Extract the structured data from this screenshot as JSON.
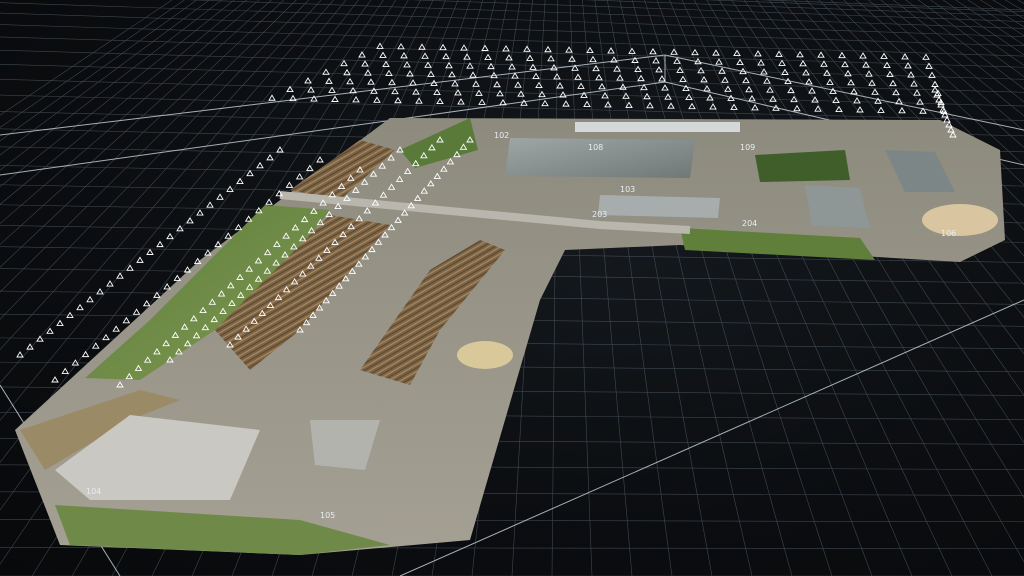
{
  "scene": {
    "type": "photogrammetry-3d-view",
    "subject": "industrial sawmill / timber yard point cloud",
    "colors": {
      "background": "#0a0c0e",
      "grid_line": "#5a6570",
      "grid_major": "#c9d2da",
      "camera_marker": "#ffffff"
    }
  },
  "gcp_labels": [
    {
      "id": "gcp-104",
      "text": "104"
    },
    {
      "id": "gcp-105",
      "text": "105"
    },
    {
      "id": "gcp-106",
      "text": "106"
    },
    {
      "id": "gcp-103",
      "text": "103"
    },
    {
      "id": "gcp-108",
      "text": "108"
    },
    {
      "id": "gcp-109",
      "text": "109"
    },
    {
      "id": "gcp-203",
      "text": "203"
    },
    {
      "id": "gcp-204",
      "text": "204"
    },
    {
      "id": "gcp-102",
      "text": "102"
    }
  ]
}
